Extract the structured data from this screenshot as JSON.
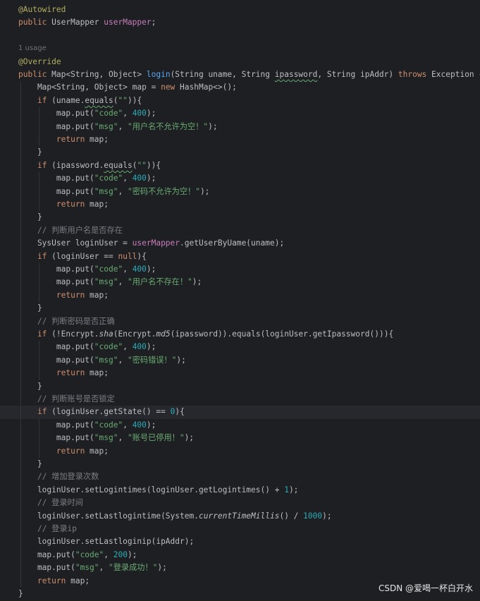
{
  "usage_hint": "1 usage",
  "watermark": "CSDN @爱喝一杯白开水",
  "lines": [
    [
      [
        "ann",
        "@Autowired"
      ]
    ],
    [
      [
        "kw",
        "public "
      ],
      [
        "",
        "UserMapper "
      ],
      [
        "fld",
        "userMapper"
      ],
      [
        "",
        ";"
      ]
    ],
    [],
    [],
    [
      [
        "ann",
        "@Override"
      ]
    ],
    [
      [
        "kw",
        "public "
      ],
      [
        "",
        "Map<String, Object> "
      ],
      [
        "fn",
        "login"
      ],
      [
        "",
        "(String uname, String "
      ],
      [
        "wavy",
        "ipassword"
      ],
      [
        "",
        ", String ipAddr) "
      ],
      [
        "kw",
        "throws "
      ],
      [
        "",
        "Exception {"
      ]
    ],
    [
      [
        "",
        "    Map<String, Object> map = "
      ],
      [
        "kw",
        "new "
      ],
      [
        "",
        "HashMap<>();"
      ]
    ],
    [
      [
        "",
        "    "
      ],
      [
        "kw",
        "if "
      ],
      [
        "",
        "(uname."
      ],
      [
        "wavy",
        "equals"
      ],
      [
        "",
        "("
      ],
      [
        "str",
        "\"\""
      ],
      [
        "",
        "))"
      ],
      [
        "",
        "{"
      ]
    ],
    [
      [
        "",
        "        map.put("
      ],
      [
        "str",
        "\"code\""
      ],
      [
        "",
        ", "
      ],
      [
        "num",
        "400"
      ],
      [
        "",
        ");"
      ]
    ],
    [
      [
        "",
        "        map.put("
      ],
      [
        "str",
        "\"msg\""
      ],
      [
        "",
        ", "
      ],
      [
        "str",
        "\"用户名不允许为空！\""
      ],
      [
        "",
        ");"
      ]
    ],
    [
      [
        "",
        "        "
      ],
      [
        "kw",
        "return "
      ],
      [
        "",
        "map;"
      ]
    ],
    [
      [
        "",
        "    }"
      ]
    ],
    [
      [
        "",
        "    "
      ],
      [
        "kw",
        "if "
      ],
      [
        "",
        "(ipassword."
      ],
      [
        "wavy",
        "equals"
      ],
      [
        "",
        "("
      ],
      [
        "str",
        "\"\""
      ],
      [
        "",
        "))"
      ],
      [
        "",
        "{"
      ]
    ],
    [
      [
        "",
        "        map.put("
      ],
      [
        "str",
        "\"code\""
      ],
      [
        "",
        ", "
      ],
      [
        "num",
        "400"
      ],
      [
        "",
        ");"
      ]
    ],
    [
      [
        "",
        "        map.put("
      ],
      [
        "str",
        "\"msg\""
      ],
      [
        "",
        ", "
      ],
      [
        "str",
        "\"密码不允许为空！\""
      ],
      [
        "",
        ");"
      ]
    ],
    [
      [
        "",
        "        "
      ],
      [
        "kw",
        "return "
      ],
      [
        "",
        "map;"
      ]
    ],
    [
      [
        "",
        "    }"
      ]
    ],
    [
      [
        "",
        "    "
      ],
      [
        "cm",
        "// 判断用户名是否存在"
      ]
    ],
    [
      [
        "",
        "    SysUser loginUser = "
      ],
      [
        "fld",
        "userMapper"
      ],
      [
        "",
        ".getUserByUame(uname);"
      ]
    ],
    [
      [
        "",
        "    "
      ],
      [
        "kw",
        "if "
      ],
      [
        "",
        "(loginUser == "
      ],
      [
        "kw",
        "null"
      ],
      [
        "",
        ")"
      ],
      [
        "",
        "{"
      ]
    ],
    [
      [
        "",
        "        map.put("
      ],
      [
        "str",
        "\"code\""
      ],
      [
        "",
        ", "
      ],
      [
        "num",
        "400"
      ],
      [
        "",
        ");"
      ]
    ],
    [
      [
        "",
        "        map.put("
      ],
      [
        "str",
        "\"msg\""
      ],
      [
        "",
        ", "
      ],
      [
        "str",
        "\"用户名不存在！\""
      ],
      [
        "",
        ");"
      ]
    ],
    [
      [
        "",
        "        "
      ],
      [
        "kw",
        "return "
      ],
      [
        "",
        "map;"
      ]
    ],
    [
      [
        "",
        "    }"
      ]
    ],
    [
      [
        "",
        "    "
      ],
      [
        "cm",
        "// 判断密码是否正确"
      ]
    ],
    [
      [
        "",
        "    "
      ],
      [
        "kw",
        "if "
      ],
      [
        "",
        "(!Encrypt."
      ],
      [
        "it",
        "sha"
      ],
      [
        "",
        "(Encrypt."
      ],
      [
        "it",
        "md5"
      ],
      [
        "",
        "(ipassword)).equals(loginUser.getIpassword()))"
      ],
      [
        "",
        "{"
      ]
    ],
    [
      [
        "",
        "        map.put("
      ],
      [
        "str",
        "\"code\""
      ],
      [
        "",
        ", "
      ],
      [
        "num",
        "400"
      ],
      [
        "",
        ");"
      ]
    ],
    [
      [
        "",
        "        map.put("
      ],
      [
        "str",
        "\"msg\""
      ],
      [
        "",
        ", "
      ],
      [
        "str",
        "\"密码错误！\""
      ],
      [
        "",
        ");"
      ]
    ],
    [
      [
        "",
        "        "
      ],
      [
        "kw",
        "return "
      ],
      [
        "",
        "map;"
      ]
    ],
    [
      [
        "",
        "    }"
      ]
    ],
    [
      [
        "",
        "    "
      ],
      [
        "cm",
        "// 判断账号是否锁定"
      ]
    ],
    [
      [
        "",
        "    "
      ],
      [
        "kw",
        "if "
      ],
      [
        "",
        "(loginUser.getState() == "
      ],
      [
        "num",
        "0"
      ],
      [
        "",
        ")"
      ],
      [
        "",
        "{"
      ]
    ],
    [
      [
        "",
        "        map.put("
      ],
      [
        "str",
        "\"code\""
      ],
      [
        "",
        ", "
      ],
      [
        "num",
        "400"
      ],
      [
        "",
        ");"
      ]
    ],
    [
      [
        "",
        "        map.put("
      ],
      [
        "str",
        "\"msg\""
      ],
      [
        "",
        ", "
      ],
      [
        "str",
        "\"账号已停用！\""
      ],
      [
        "",
        ");"
      ]
    ],
    [
      [
        "",
        "        "
      ],
      [
        "kw",
        "return "
      ],
      [
        "",
        "map;"
      ]
    ],
    [
      [
        "",
        "    }"
      ]
    ],
    [
      [
        "",
        "    "
      ],
      [
        "cm",
        "// 增加登录次数"
      ]
    ],
    [
      [
        "",
        "    loginUser.setLogintimes(loginUser.getLogintimes() + "
      ],
      [
        "num",
        "1"
      ],
      [
        "",
        ");"
      ]
    ],
    [
      [
        "",
        "    "
      ],
      [
        "cm",
        "// 登录时间"
      ]
    ],
    [
      [
        "",
        "    loginUser.setLastlogintime(System."
      ],
      [
        "it",
        "currentTimeMillis"
      ],
      [
        "",
        "() / "
      ],
      [
        "num",
        "1000"
      ],
      [
        "",
        ");"
      ]
    ],
    [
      [
        "",
        "    "
      ],
      [
        "cm",
        "// 登录ip"
      ]
    ],
    [
      [
        "",
        "    loginUser.setLastloginip(ipAddr);"
      ]
    ],
    [
      [
        "",
        "    map.put("
      ],
      [
        "str",
        "\"code\""
      ],
      [
        "",
        ", "
      ],
      [
        "num",
        "200"
      ],
      [
        "",
        ");"
      ]
    ],
    [
      [
        "",
        "    map.put("
      ],
      [
        "str",
        "\"msg\""
      ],
      [
        "",
        ", "
      ],
      [
        "str",
        "\"登录成功！\""
      ],
      [
        "",
        ");"
      ]
    ],
    [
      [
        "",
        "    "
      ],
      [
        "kw",
        "return "
      ],
      [
        "",
        "map;"
      ]
    ],
    [
      [
        "",
        "}"
      ]
    ]
  ],
  "highlighted_line": 31
}
